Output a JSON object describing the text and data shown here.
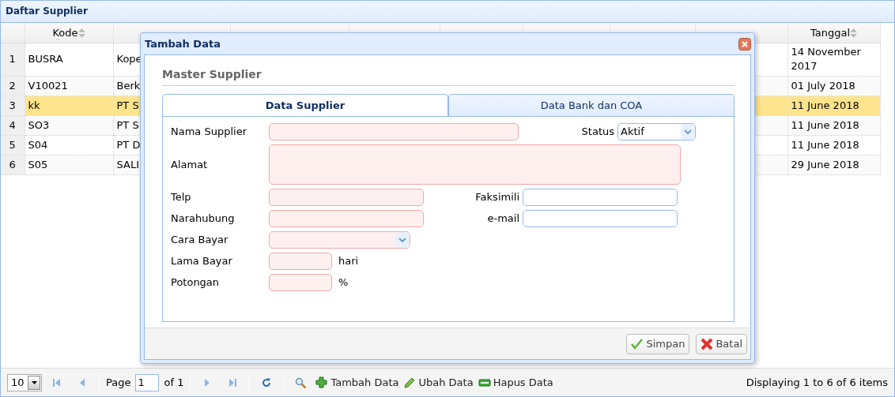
{
  "panel": {
    "title": "Daftar Supplier"
  },
  "table": {
    "columns": [
      "",
      "Kode",
      "",
      "",
      "",
      "",
      "",
      "",
      "",
      "Tanggal"
    ],
    "rows": [
      {
        "selected": false,
        "cells": [
          "1",
          "BUSRA",
          "Kope",
          "",
          "",
          "",
          "",
          "",
          "",
          "14 November 2017"
        ]
      },
      {
        "selected": false,
        "cells": [
          "2",
          "V10021",
          "Berk",
          "",
          "",
          "",
          "",
          "",
          "",
          "01 July 2018"
        ]
      },
      {
        "selected": true,
        "cells": [
          "3",
          "kk",
          "PT S",
          "",
          "",
          "",
          "",
          "",
          "",
          "11 June 2018"
        ]
      },
      {
        "selected": false,
        "cells": [
          "4",
          "SO3",
          "PT S",
          "",
          "",
          "",
          "",
          "",
          "",
          "11 June 2018"
        ]
      },
      {
        "selected": false,
        "cells": [
          "5",
          "S04",
          "PT D",
          "",
          "",
          "",
          "",
          "",
          "",
          "11 June 2018"
        ]
      },
      {
        "selected": false,
        "cells": [
          "6",
          "S05",
          "SALI",
          "",
          "",
          "",
          "",
          "",
          "",
          "29 June 2018"
        ]
      }
    ]
  },
  "dialog": {
    "title": "Tambah Data",
    "heading": "Master Supplier",
    "tabs": [
      {
        "label": "Data Supplier",
        "selected": true
      },
      {
        "label": "Data Bank dan COA",
        "selected": false
      }
    ],
    "form": [
      {
        "label": "Nama Supplier",
        "kind": "text",
        "required": true,
        "side": {
          "label": "Status",
          "kind": "select",
          "value": "Aktif",
          "required": false
        }
      },
      {
        "label": "Alamat",
        "kind": "textarea",
        "required": true
      },
      {
        "label": "Telp",
        "kind": "text",
        "required": true,
        "side": {
          "label": "Faksimili",
          "kind": "text",
          "required": false
        }
      },
      {
        "label": "Narahubung",
        "kind": "text",
        "required": true,
        "side": {
          "label": "e-mail",
          "kind": "text",
          "required": false
        }
      },
      {
        "label": "Cara Bayar",
        "kind": "select",
        "required": true
      },
      {
        "label": "Lama Bayar",
        "kind": "text",
        "required": true,
        "suffix": "hari"
      },
      {
        "label": "Potongan",
        "kind": "text",
        "required": true,
        "suffix": "%"
      }
    ],
    "buttons": [
      {
        "label": "Simpan",
        "kind": "ok"
      },
      {
        "label": "Batal",
        "kind": "cancel"
      }
    ]
  },
  "pager": {
    "page_size": "10",
    "page_label": "Page",
    "page_value": "1",
    "of_label": "of 1",
    "actions": [
      {
        "kind": "first"
      },
      {
        "kind": "prev"
      },
      {
        "kind": "sep"
      },
      {
        "kind": "page"
      },
      {
        "kind": "sep"
      },
      {
        "kind": "next"
      },
      {
        "kind": "last"
      },
      {
        "kind": "sep"
      },
      {
        "kind": "refresh"
      },
      {
        "kind": "sep"
      },
      {
        "kind": "search"
      },
      {
        "kind": "add",
        "label": "Tambah Data"
      },
      {
        "kind": "edit",
        "label": "Ubah Data"
      },
      {
        "kind": "delete",
        "label": "Hapus Data"
      }
    ],
    "display": "Displaying 1 to 6 of 6 items"
  }
}
